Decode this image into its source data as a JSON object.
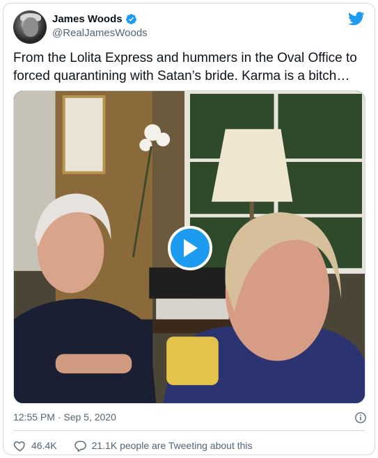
{
  "author": {
    "display_name": "James Woods",
    "handle": "@RealJamesWoods",
    "verified": true
  },
  "tweet": {
    "text": "From the Lolita Express and hummers in the Oval Office to forced quarantining with Satan’s bride. Karma is a bitch…",
    "timestamp": "12:55 PM · Sep 5, 2020"
  },
  "media": {
    "type": "video",
    "play_icon": "play-icon"
  },
  "stats": {
    "likes": "46.4K",
    "retweets_text": "21.1K people are Tweeting about this"
  },
  "icons": {
    "logo": "twitter-bird-icon",
    "verified": "verified-badge-icon",
    "info": "info-icon",
    "like": "heart-icon",
    "reply": "speech-bubble-icon"
  },
  "colors": {
    "accent": "#1d9bf0",
    "text_primary": "#0f1419",
    "text_secondary": "#536471",
    "border": "#cfd9de"
  }
}
